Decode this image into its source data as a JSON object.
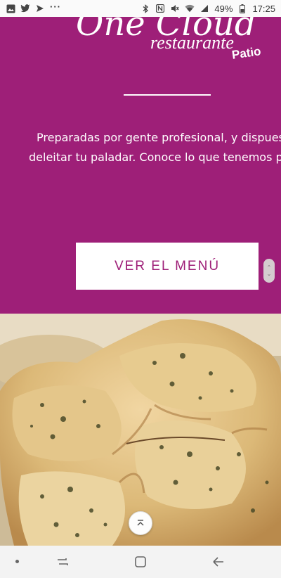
{
  "status_bar": {
    "more": "···",
    "battery": "49%",
    "time": "17:25"
  },
  "hero": {
    "logo": {
      "script": "One Cloud",
      "sub": "restaurante",
      "badge": "Patio"
    },
    "tagline_line1": "Preparadas por gente profesional, y dispuestas para",
    "tagline_line2": "deleitar tu paladar. Conoce lo que tenemos para ti.",
    "menu_button_label": "VER EL MENÚ"
  },
  "colors": {
    "brand": "#9e1f78",
    "button_bg": "#ffffff"
  },
  "icons": {
    "status_left": [
      "gallery-icon",
      "twitter-icon",
      "send-icon"
    ],
    "status_right": [
      "bluetooth-icon",
      "nfc-icon",
      "mute-icon",
      "wifi-icon",
      "signal-icon",
      "battery-icon"
    ],
    "back_to_top": "chevron-up-icon",
    "nav": [
      "nav-dot-icon",
      "recent-apps-icon",
      "home-icon",
      "back-icon"
    ]
  }
}
